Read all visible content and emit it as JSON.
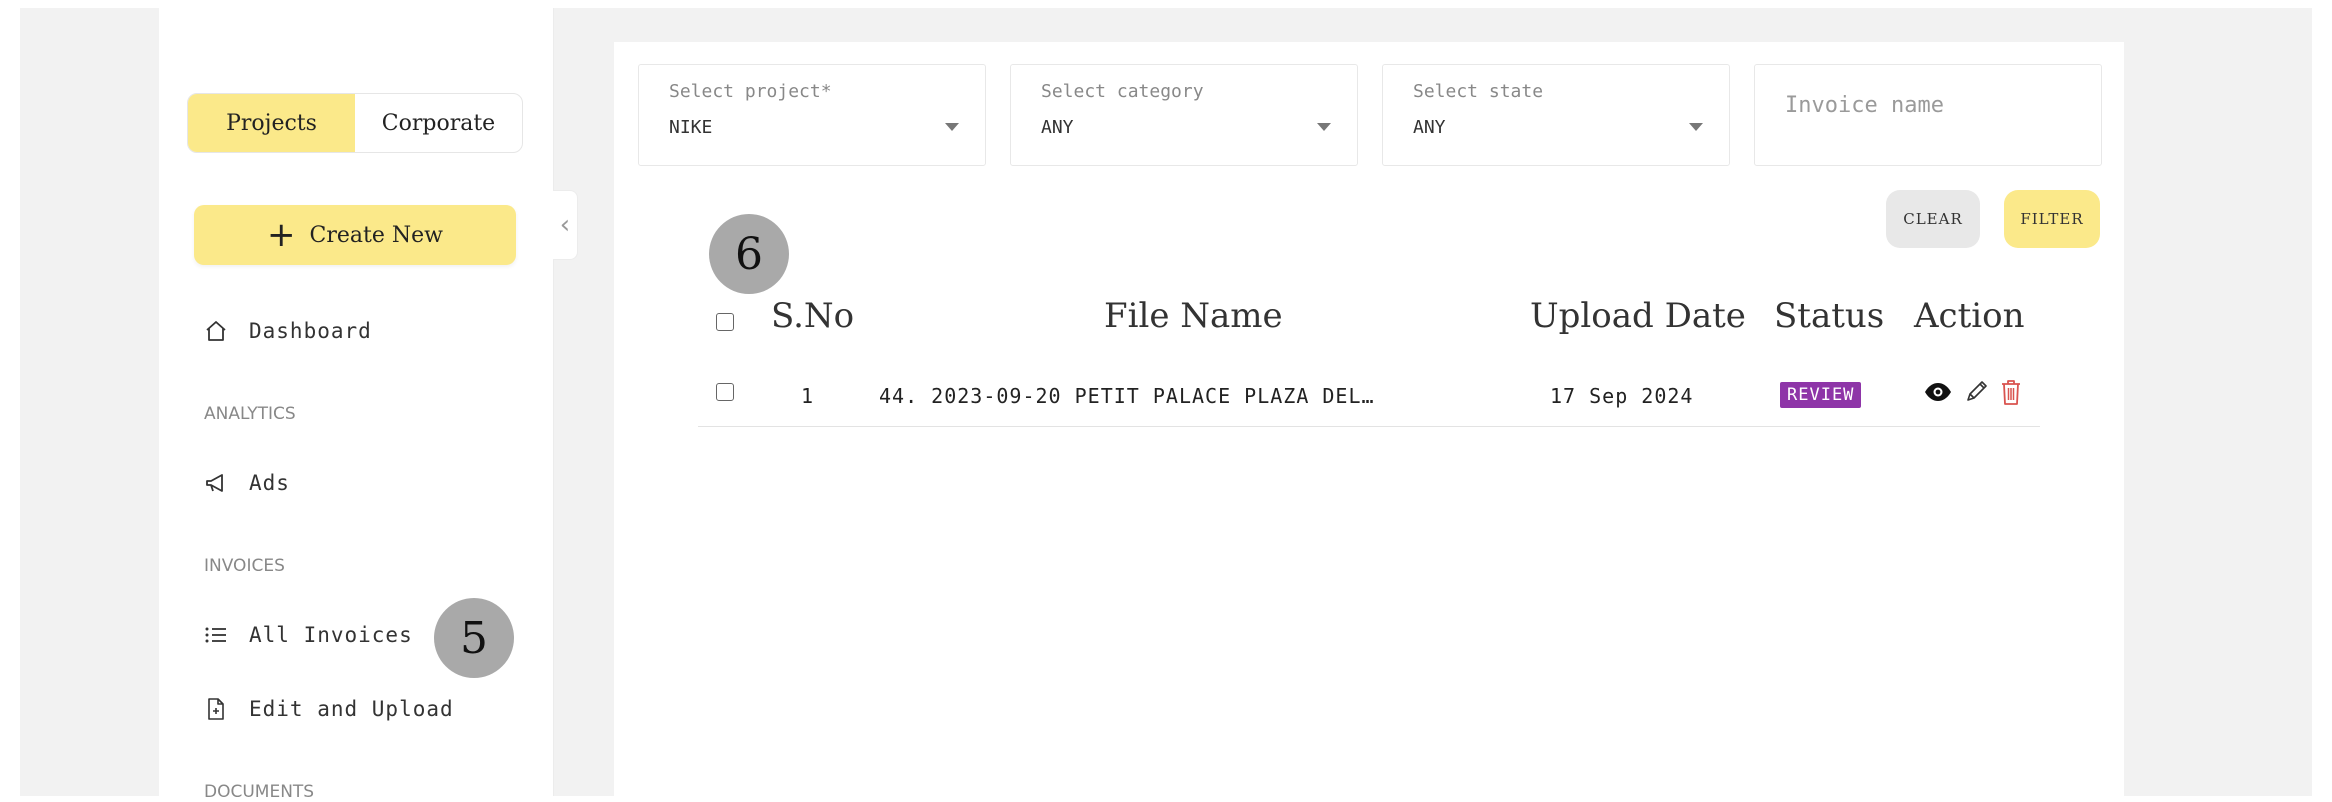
{
  "sidebar": {
    "toggle": {
      "projects": "Projects",
      "corporate": "Corporate",
      "active": "projects"
    },
    "create_new": "Create New",
    "items": [
      {
        "label": "Dashboard",
        "icon": "home-icon"
      },
      {
        "label": "Ads",
        "icon": "megaphone-icon"
      },
      {
        "label": "All Invoices",
        "icon": "list-icon"
      },
      {
        "label": "Edit and Upload",
        "icon": "file-plus-icon"
      }
    ],
    "sections": {
      "analytics": "ANALYTICS",
      "invoices": "INVOICES",
      "documents": "DOCUMENTS"
    }
  },
  "filters": {
    "project": {
      "label": "Select project*",
      "value": "NIKE"
    },
    "category": {
      "label": "Select category",
      "value": "ANY"
    },
    "state": {
      "label": "Select state",
      "value": "ANY"
    },
    "invoice_name": {
      "placeholder": "Invoice name"
    }
  },
  "buttons": {
    "clear": "CLEAR",
    "filter": "FILTER"
  },
  "markers": {
    "sidebar": "5",
    "table": "6"
  },
  "table": {
    "headers": {
      "sno": "S.No",
      "file_name": "File Name",
      "upload_date": "Upload Date",
      "status": "Status",
      "action": "Action"
    },
    "rows": [
      {
        "sno": "1",
        "file_name": "44. 2023-09-20 PETIT PALACE PLAZA DEL…",
        "upload_date": "17 Sep 2024",
        "status": "REVIEW"
      }
    ]
  },
  "colors": {
    "accent_yellow": "#fbe98a",
    "status_review": "#8e35a8",
    "delete_red": "#d9534f",
    "marker_gray": "#a9a9a9"
  }
}
